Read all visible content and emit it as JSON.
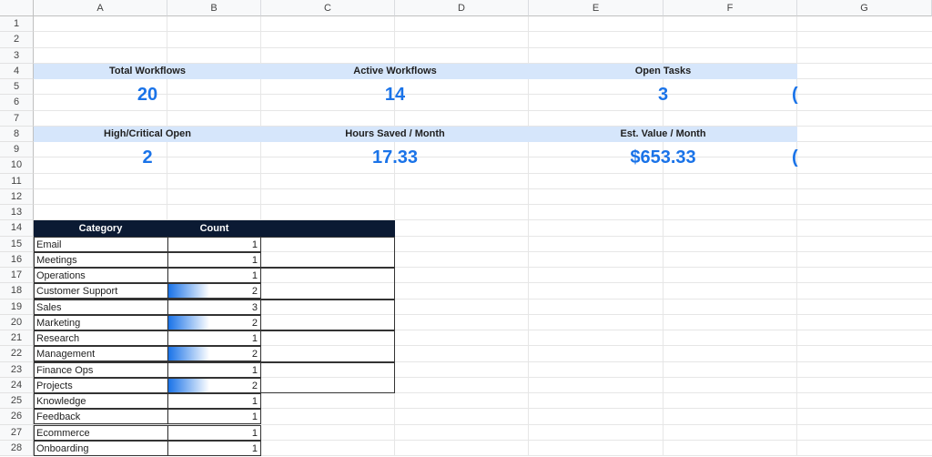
{
  "columns": [
    "A",
    "B",
    "C",
    "D",
    "E",
    "F",
    "G"
  ],
  "rows": [
    "1",
    "2",
    "3",
    "4",
    "5",
    "6",
    "7",
    "8",
    "9",
    "10",
    "11",
    "12",
    "13",
    "14",
    "15",
    "16",
    "17",
    "18",
    "19",
    "20",
    "21",
    "22",
    "23",
    "24",
    "25",
    "26",
    "27",
    "28"
  ],
  "kpis": [
    {
      "label": "Total Workflows",
      "value": "20"
    },
    {
      "label": "Active Workflows",
      "value": "14"
    },
    {
      "label": "Open Tasks",
      "value": "3"
    },
    {
      "label": "High/Critical Open",
      "value": "2"
    },
    {
      "label": "Hours Saved / Month",
      "value": "17.33"
    },
    {
      "label": "Est. Value / Month",
      "value": "$653.33"
    }
  ],
  "kpi_overflow": [
    "(",
    "("
  ],
  "table": {
    "headers": [
      "Category",
      "Count"
    ],
    "rows": [
      {
        "category": "Email",
        "count": 1
      },
      {
        "category": "Meetings",
        "count": 1
      },
      {
        "category": "Operations",
        "count": 1
      },
      {
        "category": "Customer Support",
        "count": 2
      },
      {
        "category": "Sales",
        "count": 3
      },
      {
        "category": "Marketing",
        "count": 2
      },
      {
        "category": "Research",
        "count": 1
      },
      {
        "category": "Management",
        "count": 2
      },
      {
        "category": "Finance Ops",
        "count": 1
      },
      {
        "category": "Projects",
        "count": 2
      },
      {
        "category": "Knowledge",
        "count": 1
      },
      {
        "category": "Feedback",
        "count": 1
      },
      {
        "category": "Ecommerce",
        "count": 1
      },
      {
        "category": "Onboarding",
        "count": 1
      }
    ]
  },
  "colors": {
    "accent": "#1a73e8",
    "header_bg": "#0b1a33",
    "kpi_label_bg": "#d6e6fb"
  }
}
